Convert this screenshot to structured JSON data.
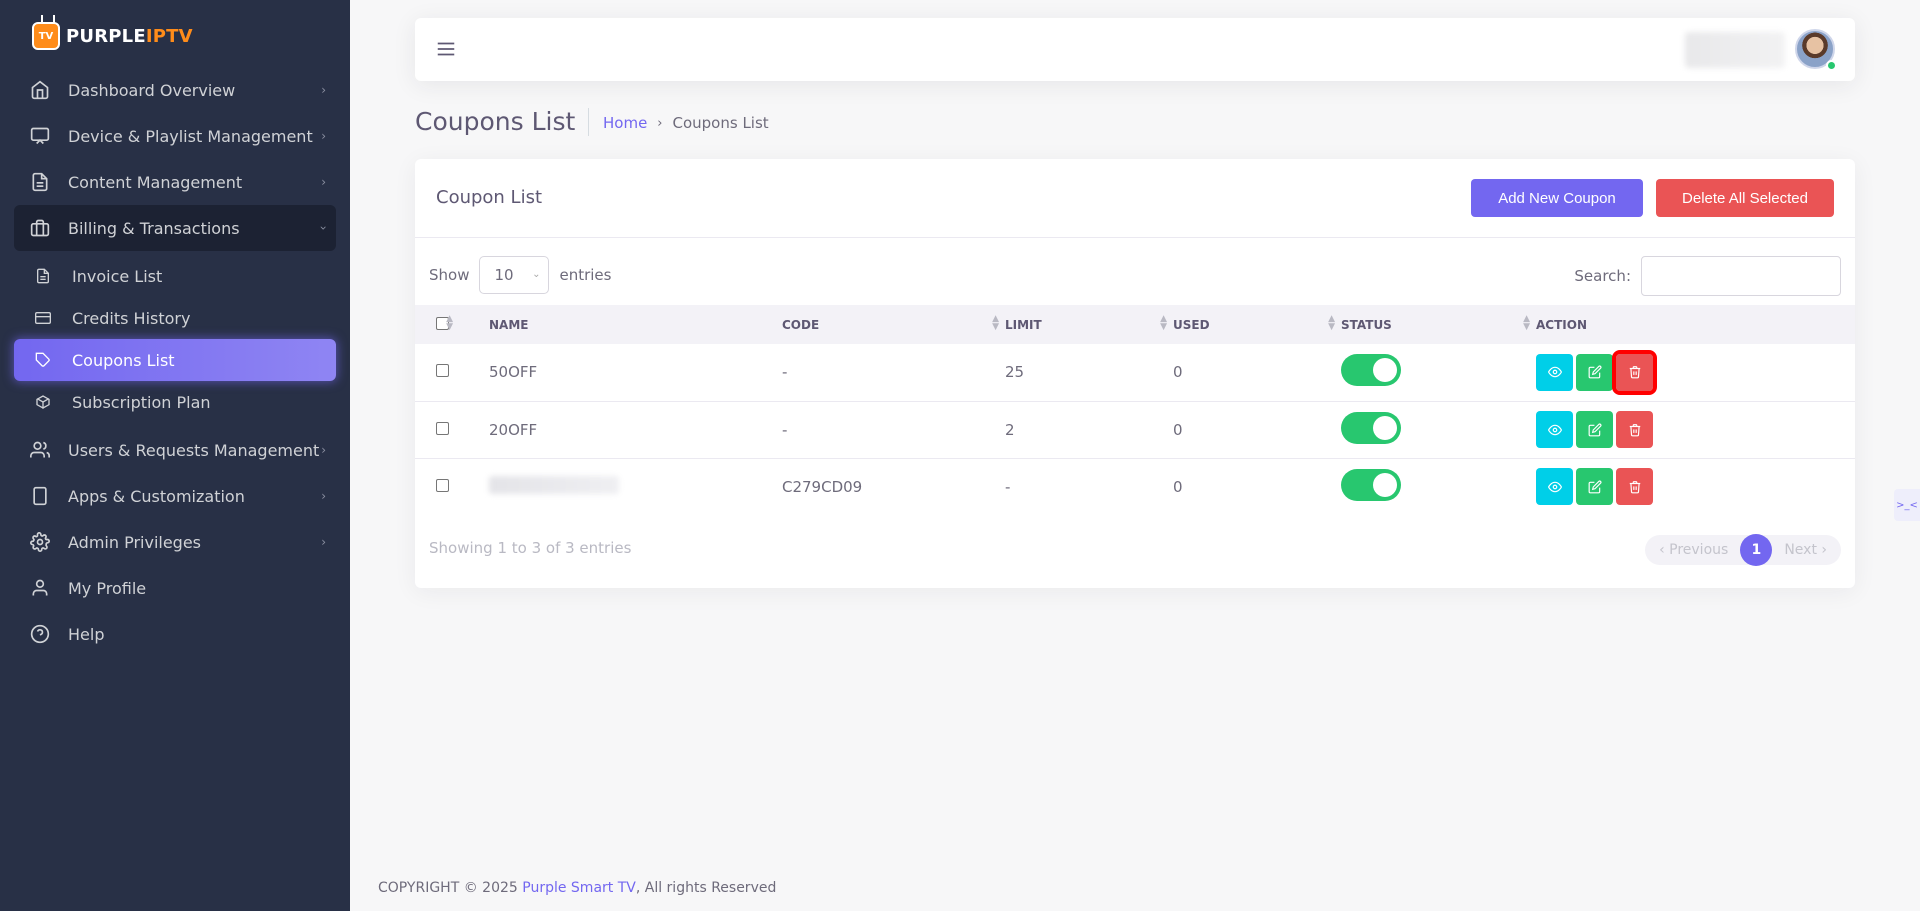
{
  "brand": {
    "name_main": "PURPLE",
    "name_accent": "IPTV",
    "accent_color": "#ff8c1a",
    "logo_letters": "TV"
  },
  "sidebar": {
    "items": [
      {
        "label": "Dashboard Overview",
        "icon": "home-icon"
      },
      {
        "label": "Device & Playlist Management",
        "icon": "monitor-icon"
      },
      {
        "label": "Content Management",
        "icon": "file-text-icon"
      },
      {
        "label": "Billing & Transactions",
        "icon": "briefcase-icon",
        "expanded": true
      },
      {
        "label": "Users & Requests Management",
        "icon": "users-icon"
      },
      {
        "label": "Apps & Customization",
        "icon": "tablet-icon"
      },
      {
        "label": "Admin Privileges",
        "icon": "settings-icon"
      },
      {
        "label": "My Profile",
        "icon": "user-icon"
      },
      {
        "label": "Help",
        "icon": "help-circle-icon"
      }
    ],
    "sub_items": [
      {
        "label": "Invoice List",
        "icon": "file-icon"
      },
      {
        "label": "Credits History",
        "icon": "credit-card-icon"
      },
      {
        "label": "Coupons List",
        "icon": "tag-icon",
        "active": true
      },
      {
        "label": "Subscription Plan",
        "icon": "box-icon"
      }
    ]
  },
  "page": {
    "title": "Coupons List",
    "breadcrumb": {
      "home": "Home",
      "current": "Coupons List"
    }
  },
  "card": {
    "title": "Coupon List",
    "add_button": "Add New Coupon",
    "delete_selected_button": "Delete All Selected",
    "length_prefix": "Show",
    "length_value": "10",
    "length_suffix": "entries",
    "search_label": "Search:",
    "search_value": ""
  },
  "table": {
    "columns": [
      "Name",
      "Code",
      "Limit",
      "Used",
      "Status",
      "Action"
    ],
    "rows": [
      {
        "name": "50OFF",
        "code": "-",
        "limit": "25",
        "used": "0",
        "status": "on"
      },
      {
        "name": "20OFF",
        "code": "-",
        "limit": "2",
        "used": "0",
        "status": "on"
      },
      {
        "name": "",
        "code": "C279CD09",
        "limit": "-",
        "used": "0",
        "status": "on"
      }
    ]
  },
  "pagination": {
    "info": "Showing 1 to 3 of 3 entries",
    "previous": "Previous",
    "page": "1",
    "next": "Next"
  },
  "footer": {
    "prefix": "COPYRIGHT © 2025 ",
    "link": "Purple Smart TV",
    "suffix": ", All rights Reserved"
  },
  "colors": {
    "primary": "#7367f0",
    "danger": "#ea5455",
    "success": "#28c76f",
    "info": "#00cfe8",
    "sidebar_bg": "#283046"
  }
}
